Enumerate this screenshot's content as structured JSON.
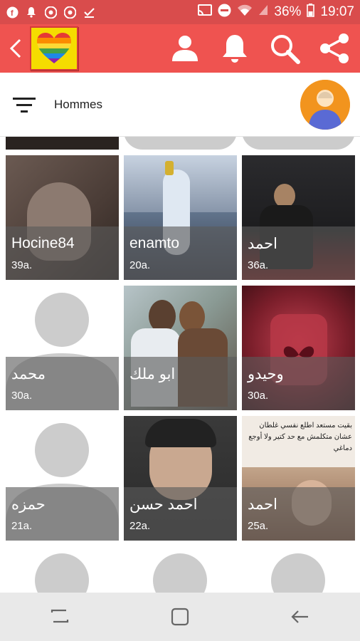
{
  "status_bar": {
    "battery": "36%",
    "time": "19:07"
  },
  "app_bar": {
    "logo_icon": "rainbow-heart-icon",
    "actions": [
      "profile-icon",
      "notifications-bell-icon",
      "search-icon",
      "share-icon"
    ]
  },
  "filter": {
    "label": "Hommes"
  },
  "profiles": [
    {
      "name": "Hocine84",
      "age": "39a.",
      "photo": "photo"
    },
    {
      "name": "enamto",
      "age": "20a.",
      "photo": "photo"
    },
    {
      "name": "احمد",
      "age": "36a.",
      "photo": "photo"
    },
    {
      "name": "محمد",
      "age": "30a.",
      "photo": "placeholder"
    },
    {
      "name": "ابو ملك",
      "age": "",
      "photo": "photo"
    },
    {
      "name": "وحيدو",
      "age": "30a.",
      "photo": "photo"
    },
    {
      "name": "حمزه",
      "age": "21a.",
      "photo": "placeholder"
    },
    {
      "name": "احمد حسن",
      "age": "22a.",
      "photo": "photo"
    },
    {
      "name": "احمد",
      "age": "25a.",
      "photo": "photo"
    }
  ],
  "card_text_overlay": "بقيت مستعد اطلع نفسي غلطان عشان متكلمش مع حد كتير ولا أوجع دماغي",
  "colors": {
    "status_bar": "#d94c4c",
    "app_bar": "#ef5350",
    "logo_bg": "#f5dc00",
    "avatar_orange": "#f2941e"
  }
}
